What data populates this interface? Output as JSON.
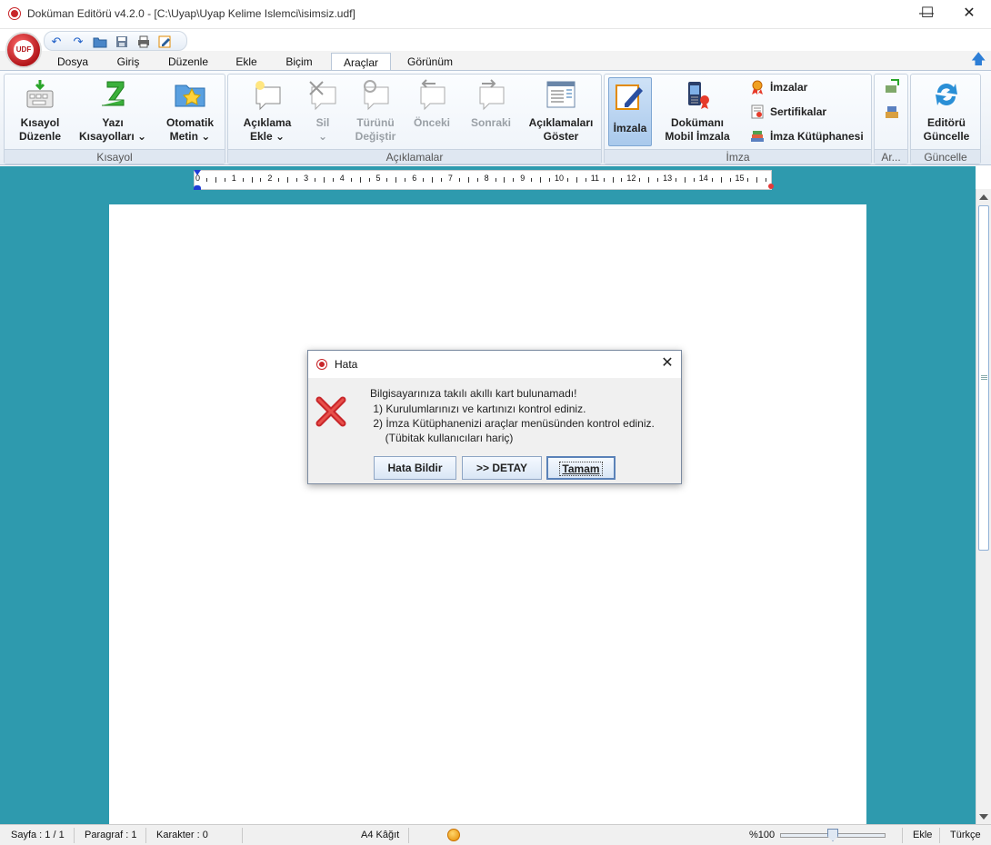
{
  "window": {
    "title": "Doküman Editörü v4.2.0 - [C:\\Uyap\\Uyap Kelime Islemci\\isimsiz.udf]",
    "minimize": "—",
    "maximize": "☐",
    "close": "✕"
  },
  "logo": {
    "text": "UDF"
  },
  "menu_tabs": [
    "Dosya",
    "Giriş",
    "Düzenle",
    "Ekle",
    "Biçim",
    "Araçlar",
    "Görünüm"
  ],
  "active_tab": "Araçlar",
  "ribbon": {
    "kisayol": {
      "label": "Kısayol",
      "buttons": [
        {
          "line1": "Kısayol",
          "line2": "Düzenle"
        },
        {
          "line1": "Yazı",
          "line2": "Kısayolları ⌄"
        },
        {
          "line1": "Otomatik",
          "line2": "Metin ⌄"
        }
      ]
    },
    "aciklamalar": {
      "label": "Açıklamalar",
      "buttons": [
        {
          "line1": "Açıklama",
          "line2": "Ekle ⌄"
        },
        {
          "line1": "Sil",
          "line2": "⌄"
        },
        {
          "line1": "Türünü",
          "line2": "Değiştir"
        },
        {
          "line1": "Önceki",
          "line2": ""
        },
        {
          "line1": "Sonraki",
          "line2": ""
        },
        {
          "line1": "Açıklamaları",
          "line2": "Göster"
        }
      ]
    },
    "imza": {
      "label": "İmza",
      "imzala": "İmzala",
      "mobil_line1": "Dokümanı",
      "mobil_line2": "Mobil İmzala",
      "imzalar": "İmzalar",
      "sertifikalar": "Sertifikalar",
      "kutuphane": "İmza Kütüphanesi"
    },
    "ar": {
      "label": "Ar..."
    },
    "guncelle": {
      "label": "Güncelle",
      "line1": "Editörü",
      "line2": "Güncelle"
    }
  },
  "ruler": {
    "numbers": [
      "0",
      "1",
      "2",
      "3",
      "4",
      "5",
      "6",
      "7",
      "8",
      "9",
      "10",
      "11",
      "12",
      "13",
      "14",
      "15"
    ]
  },
  "status": {
    "sayfa": "Sayfa : 1 / 1",
    "paragraf": "Paragraf : 1",
    "karakter": "Karakter : 0",
    "kagit": "A4 Kâğıt",
    "zoom": "%100",
    "mode": "Ekle",
    "language": "Türkçe",
    "zoom_level": 0.5
  },
  "dialog": {
    "title": "Hata",
    "close": "✕",
    "message_lines": [
      "Bilgisayarınıza takılı akıllı kart bulunamadı!",
      " 1) Kurulumlarınızı ve kartınızı kontrol ediniz.",
      " 2) İmza Kütüphanenizi araçlar menüsünden kontrol ediniz.",
      "     (Tübitak kullanıcıları hariç)"
    ],
    "buttons": {
      "report": "Hata Bildir",
      "detail": ">> DETAY",
      "ok": "Tamam"
    }
  }
}
